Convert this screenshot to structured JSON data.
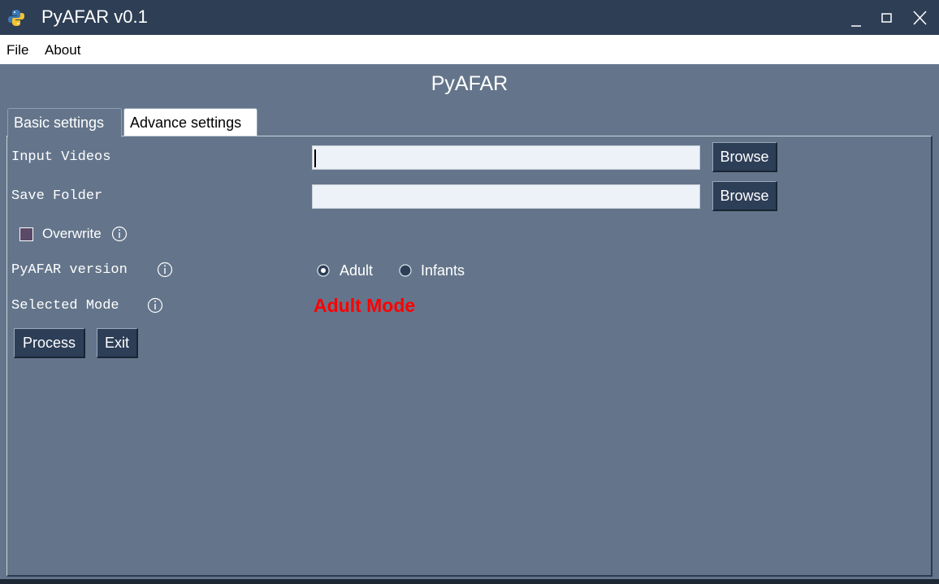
{
  "window": {
    "title": "PyAFAR v0.1",
    "controls": {
      "minimize": "_",
      "maximize": "□",
      "close": "X"
    },
    "colors": {
      "titlebar": "#2e3e55",
      "background": "#64758b",
      "button": "#2d3e57",
      "mode_text": "#ff0000"
    }
  },
  "menu": {
    "items": [
      "File",
      "About"
    ]
  },
  "header": {
    "title": "PyAFAR"
  },
  "tabs": [
    {
      "label": "Basic settings",
      "active": true
    },
    {
      "label": "Advance settings",
      "active": false
    }
  ],
  "form": {
    "input_videos": {
      "label": "Input Videos",
      "value": "",
      "browse_label": "Browse"
    },
    "save_folder": {
      "label": "Save Folder",
      "value": "",
      "browse_label": "Browse"
    },
    "overwrite": {
      "label": "Overwrite",
      "checked": false
    },
    "version": {
      "label": "PyAFAR version",
      "options": [
        "Adult",
        "Infants"
      ],
      "selected": "Adult"
    },
    "selected_mode": {
      "label": "Selected Mode",
      "value": "Adult Mode"
    }
  },
  "actions": {
    "process_label": "Process",
    "exit_label": "Exit"
  },
  "icons": [
    "python-logo-icon",
    "minimize-icon",
    "maximize-icon",
    "close-icon",
    "info-icon",
    "radio-selected-icon",
    "radio-unselected-icon"
  ]
}
